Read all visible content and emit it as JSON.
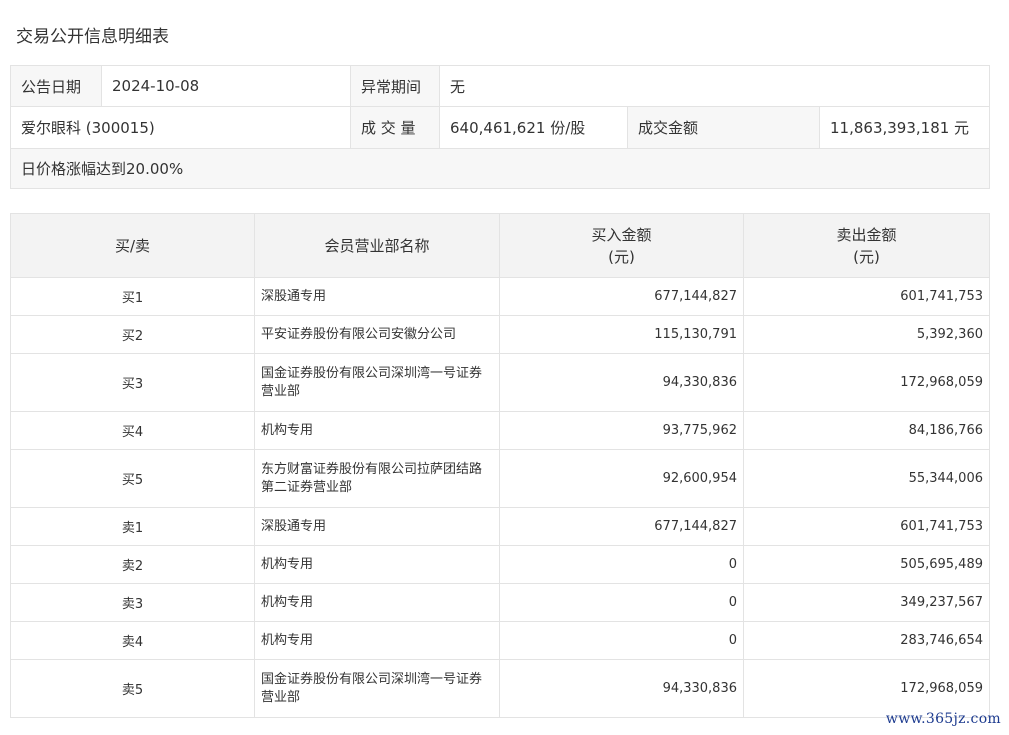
{
  "page": {
    "title": "交易公开信息明细表"
  },
  "info": {
    "date_label": "公告日期",
    "date_value": "2024-10-08",
    "abnormal_label": "异常期间",
    "abnormal_value": "无",
    "stock": "爱尔眼科 (300015)",
    "volume_label": "成 交 量",
    "volume_value": "640,461,621 份/股",
    "amount_label": "成交金额",
    "amount_value": "11,863,393,181 元",
    "reason": "日价格涨幅达到20.00%"
  },
  "detail": {
    "headers": {
      "side": "买/卖",
      "name": "会员营业部名称",
      "buy_l1": "买入金额",
      "buy_l2": "(元)",
      "sell_l1": "卖出金额",
      "sell_l2": "(元)"
    },
    "rows": [
      {
        "side": "买1",
        "name": "深股通专用",
        "buy": "677,144,827",
        "sell": "601,741,753"
      },
      {
        "side": "买2",
        "name": "平安证券股份有限公司安徽分公司",
        "buy": "115,130,791",
        "sell": "5,392,360"
      },
      {
        "side": "买3",
        "name": "国金证券股份有限公司深圳湾一号证券营业部",
        "buy": "94,330,836",
        "sell": "172,968,059"
      },
      {
        "side": "买4",
        "name": "机构专用",
        "buy": "93,775,962",
        "sell": "84,186,766"
      },
      {
        "side": "买5",
        "name": "东方财富证券股份有限公司拉萨团结路第二证券营业部",
        "buy": "92,600,954",
        "sell": "55,344,006"
      },
      {
        "side": "卖1",
        "name": "深股通专用",
        "buy": "677,144,827",
        "sell": "601,741,753"
      },
      {
        "side": "卖2",
        "name": "机构专用",
        "buy": "0",
        "sell": "505,695,489"
      },
      {
        "side": "卖3",
        "name": "机构专用",
        "buy": "0",
        "sell": "349,237,567"
      },
      {
        "side": "卖4",
        "name": "机构专用",
        "buy": "0",
        "sell": "283,746,654"
      },
      {
        "side": "卖5",
        "name": "国金证券股份有限公司深圳湾一号证券营业部",
        "buy": "94,330,836",
        "sell": "172,968,059"
      }
    ]
  },
  "watermark": "www.365jz.com"
}
